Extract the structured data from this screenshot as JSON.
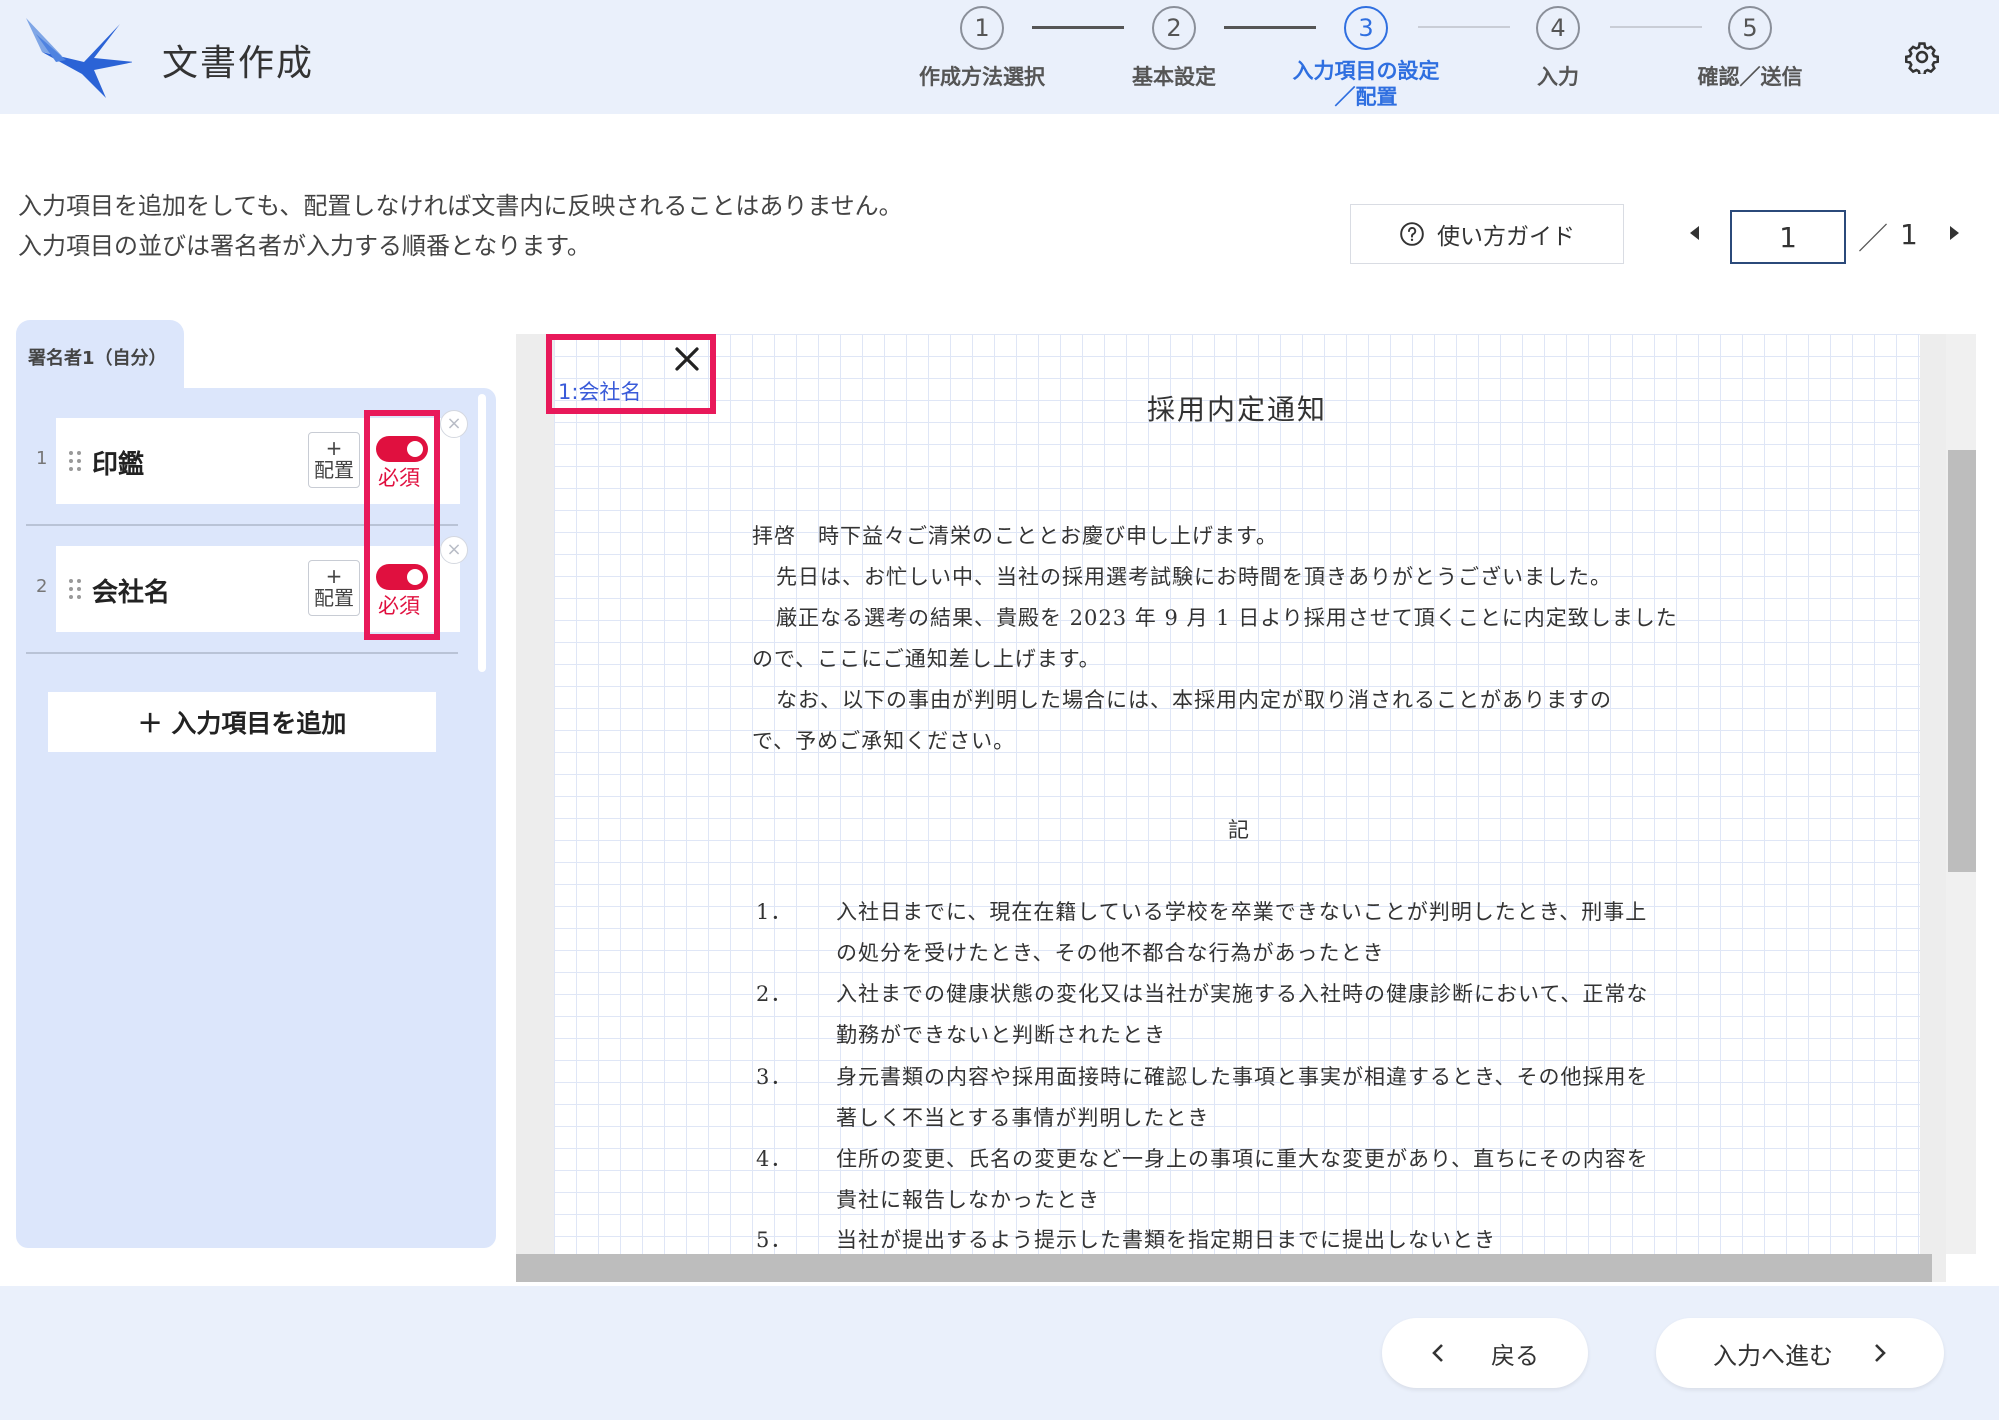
{
  "header": {
    "title": "文書作成",
    "steps": [
      {
        "num": "1",
        "label": "作成方法選択"
      },
      {
        "num": "2",
        "label": "基本設定"
      },
      {
        "num": "3",
        "label_line1": "入力項目の設定",
        "label_line2": "／配置"
      },
      {
        "num": "4",
        "label": "入力"
      },
      {
        "num": "5",
        "label": "確認／送信"
      }
    ],
    "active_step": 3
  },
  "intro": {
    "line1": "入力項目を追加をしても、配置しなければ文書内に反映されることはありません。",
    "line2": "入力項目の並びは署名者が入力する順番となります。"
  },
  "guide_button": "使い方ガイド",
  "pager": {
    "current": "1",
    "separator": "／",
    "total": "1"
  },
  "signer_tab": "署名者1（自分）",
  "fields": [
    {
      "num": "1",
      "label": "印鑑",
      "place_plus": "+",
      "place_label": "配置",
      "required": "必須",
      "remove": "×"
    },
    {
      "num": "2",
      "label": "会社名",
      "place_plus": "+",
      "place_label": "配置",
      "required": "必須",
      "remove": "×"
    }
  ],
  "add_field_button": "＋  入力項目を追加",
  "document": {
    "title": "採用内定通知",
    "lines": [
      "拝啓　時下益々ご清栄のこととお慶び申し上げます。",
      "先日は、お忙しい中、当社の採用選考試験にお時間を頂きありがとうございました。",
      "厳正なる選考の結果、貴殿を 2023 年 9 月 1 日より採用させて頂くことに内定致しました",
      "ので、ここにご通知差し上げます。",
      "なお、以下の事由が判明した場合には、本採用内定が取り消されることがありますの",
      "で、予めご承知ください。"
    ],
    "ki": "記",
    "items": [
      {
        "num": "1．",
        "line1": "入社日までに、現在在籍している学校を卒業できないことが判明したとき、刑事上",
        "line2": "の処分を受けたとき、その他不都合な行為があったとき"
      },
      {
        "num": "2．",
        "line1": "入社までの健康状態の変化又は当社が実施する入社時の健康診断において、正常な",
        "line2": "勤務ができないと判断されたとき"
      },
      {
        "num": "3．",
        "line1": "身元書類の内容や採用面接時に確認した事項と事実が相違するとき、その他採用を",
        "line2": "著しく不当とする事情が判明したとき"
      },
      {
        "num": "4．",
        "line1": "住所の変更、氏名の変更など一身上の事項に重大な変更があり、直ちにその内容を",
        "line2": "貴社に報告しなかったとき"
      },
      {
        "num": "5．",
        "line1": "当社が提出するよう提示した書類を指定期日までに提出しないとき",
        "line2": ""
      }
    ],
    "placed_field_label": "1:会社名"
  },
  "footer": {
    "back": "戻る",
    "next": "入力へ進む"
  },
  "colors": {
    "accent": "#2f6fe0",
    "required": "#e0103f",
    "highlight": "#e8195a",
    "panel": "#dce6fb",
    "header_bg": "#eaf0fb"
  }
}
